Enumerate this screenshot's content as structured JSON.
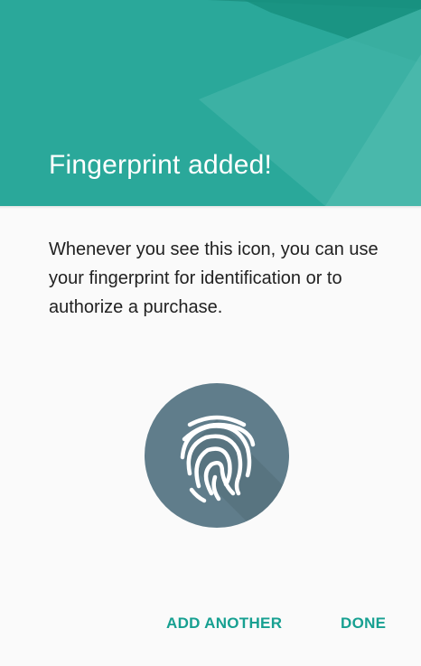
{
  "header": {
    "title": "Fingerprint added!",
    "color": "#2aa89a"
  },
  "main": {
    "description": "Whenever you see this icon, you can use your fingerprint for identification or to authorize a purchase.",
    "icon": "fingerprint-icon",
    "icon_bg_color": "#607d8b"
  },
  "actions": {
    "add_another_label": "ADD ANOTHER",
    "done_label": "DONE",
    "accent_color": "#17a091"
  }
}
